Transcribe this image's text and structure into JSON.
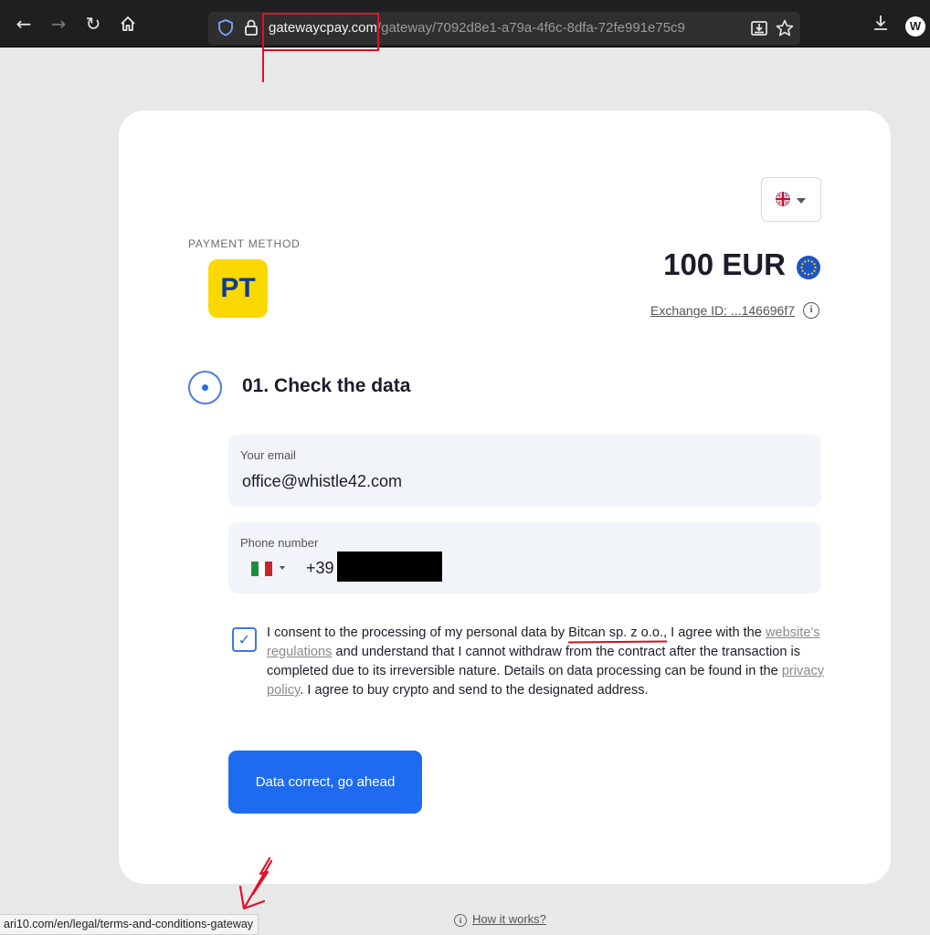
{
  "browser": {
    "url_domain": "gatewaycpay.com",
    "url_path": "/gateway/7092d8e1-a79a-4f6c-8dfa-72fe991e75c9",
    "profile_initial": "W"
  },
  "payment": {
    "method_label": "PAYMENT METHOD",
    "method_logo_text": "PT",
    "amount": "100 EUR",
    "exchange_id": "Exchange ID: ...146696f7"
  },
  "step": {
    "title": "01. Check the data"
  },
  "email_field": {
    "label": "Your email",
    "value": "office@whistle42.com"
  },
  "phone_field": {
    "label": "Phone number",
    "dial_code": "+39"
  },
  "consent": {
    "checked": true,
    "text_1": "I consent to the processing of my personal data by ",
    "company": "Bitcan sp. z o.o.",
    "text_2": ", I agree with the ",
    "regulations_link": "website's regulations",
    "text_3": " and understand that I cannot withdraw from the contract after the transaction is completed due to its irreversible nature. Details on data processing can be found in the ",
    "privacy_link": "privacy policy",
    "text_4": ". I agree to buy crypto and send to the designated address."
  },
  "submit_button": {
    "label": "Data correct, go ahead"
  },
  "footer": {
    "how_it_works": "How it works?"
  },
  "status_bar": {
    "hover_url": "ari10.com/en/legal/terms-and-conditions-gateway"
  },
  "colors": {
    "primary": "#1f6bf0",
    "annotation_red": "#e0102a",
    "logo_yellow": "#fbd800",
    "logo_blue": "#0c3d91"
  }
}
